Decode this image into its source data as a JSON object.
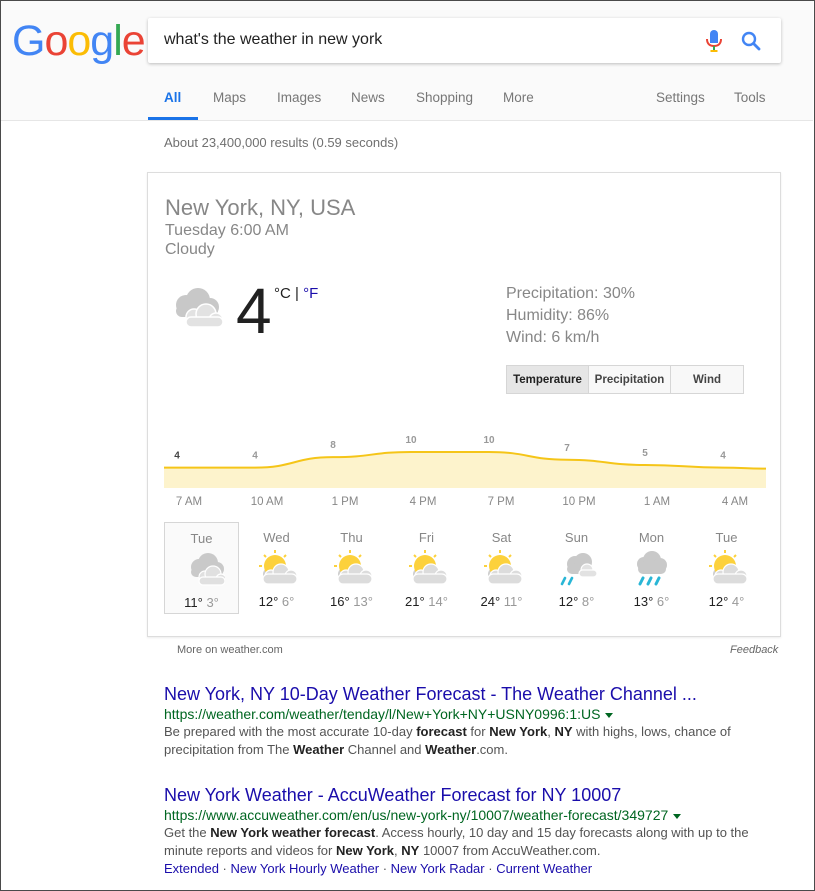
{
  "logo": {
    "letters": [
      "G",
      "o",
      "o",
      "g",
      "l",
      "e"
    ],
    "colors": [
      "#4285F4",
      "#EA4335",
      "#FBBC05",
      "#4285F4",
      "#34A853",
      "#EA4335"
    ]
  },
  "search": {
    "query": "what's the weather in new york"
  },
  "tabs": [
    {
      "label": "All"
    },
    {
      "label": "Maps"
    },
    {
      "label": "Images"
    },
    {
      "label": "News"
    },
    {
      "label": "Shopping"
    },
    {
      "label": "More"
    },
    {
      "label": "Settings"
    },
    {
      "label": "Tools"
    }
  ],
  "stats": "About 23,400,000 results (0.59 seconds)",
  "weather": {
    "location": "New York, NY, USA",
    "time": "Tuesday 6:00 AM",
    "condition": "Cloudy",
    "temperature": "4",
    "unit_c": "°C",
    "unit_sep": " | ",
    "unit_f": "°F",
    "precipitation": "Precipitation: 30%",
    "humidity": "Humidity: 86%",
    "wind": "Wind: 6 km/h",
    "toggles": [
      "Temperature",
      "Precipitation",
      "Wind"
    ],
    "hourly": {
      "labels": [
        "7 AM",
        "10 AM",
        "1 PM",
        "4 PM",
        "7 PM",
        "10 PM",
        "1 AM",
        "4 AM"
      ],
      "values": [
        4,
        4,
        8,
        10,
        10,
        7,
        5,
        4
      ]
    },
    "daily": [
      {
        "day": "Tue",
        "icon": "cloudy-icon",
        "hi": "11°",
        "lo": "3°"
      },
      {
        "day": "Wed",
        "icon": "partly-sunny-icon",
        "hi": "12°",
        "lo": "6°"
      },
      {
        "day": "Thu",
        "icon": "partly-sunny-icon",
        "hi": "16°",
        "lo": "13°"
      },
      {
        "day": "Fri",
        "icon": "partly-sunny-icon",
        "hi": "21°",
        "lo": "14°"
      },
      {
        "day": "Sat",
        "icon": "partly-sunny-icon",
        "hi": "24°",
        "lo": "11°"
      },
      {
        "day": "Sun",
        "icon": "light-rain-icon",
        "hi": "12°",
        "lo": "8°"
      },
      {
        "day": "Mon",
        "icon": "rain-icon",
        "hi": "13°",
        "lo": "6°"
      },
      {
        "day": "Tue",
        "icon": "partly-sunny-icon",
        "hi": "12°",
        "lo": "4°"
      }
    ],
    "more_link": "More on weather.com",
    "feedback": "Feedback"
  },
  "results": [
    {
      "title": "New York, NY 10-Day Weather Forecast - The Weather Channel ...",
      "url": "https://weather.com/weather/tenday/l/New+York+NY+USNY0996:1:US",
      "snippet": "Be prepared with the most accurate 10-day <b>forecast</b> for <b>New York</b>, <b>NY</b> with highs, lows, chance of precipitation from The <b>Weather</b> Channel and <b>Weather</b>.com."
    },
    {
      "title": "New York Weather - AccuWeather Forecast for NY 10007",
      "url": "https://www.accuweather.com/en/us/new-york-ny/10007/weather-forecast/349727",
      "snippet": "Get the <b>New York weather forecast</b>. Access hourly, 10 day and 15 day forecasts along with up to the minute reports and videos for <b>New York</b>, <b>NY</b> 10007 from AccuWeather.com.",
      "sitelinks": [
        "Extended",
        "New York Hourly Weather",
        "New York Radar",
        "Current Weather"
      ]
    }
  ]
}
